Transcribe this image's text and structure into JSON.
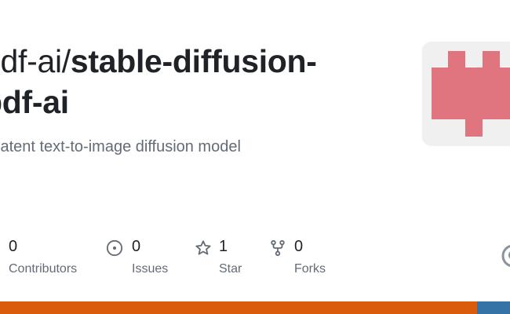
{
  "repo": {
    "owner": "pdf-ai/",
    "name_line1": "stable-diffusion-",
    "name_line2": "pdf-ai",
    "description": "latent text-to-image diffusion model"
  },
  "stats": {
    "contributors": {
      "count": "0",
      "label": "Contributors"
    },
    "issues": {
      "count": "0",
      "label": "Issues",
      "icon": "issue-opened-icon"
    },
    "stars": {
      "count": "1",
      "label": "Star",
      "icon": "star-icon"
    },
    "forks": {
      "count": "0",
      "label": "Forks",
      "icon": "repo-forked-icon"
    }
  },
  "colors": {
    "identicon": "#e07580",
    "avatar_background": "#f0f0f0",
    "title_text": "#1f2328",
    "muted_text": "#636c76",
    "language_primary": "#da5b0b",
    "language_secondary": "#3572a5"
  },
  "languages": [
    {
      "color": "#da5b0b",
      "share": 0.935
    },
    {
      "color": "#3572a5",
      "share": 0.065
    }
  ]
}
